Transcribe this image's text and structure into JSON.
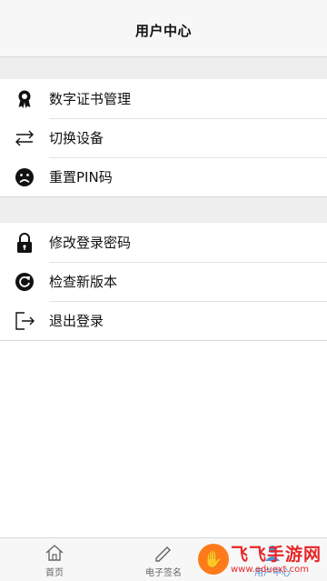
{
  "header": {
    "title": "用户中心"
  },
  "group1": [
    {
      "label": "数字证书管理",
      "icon": "certificate-ribbon-icon"
    },
    {
      "label": "切换设备",
      "icon": "swap-arrows-icon"
    },
    {
      "label": "重置PIN码",
      "icon": "sad-face-icon"
    }
  ],
  "group2": [
    {
      "label": "修改登录密码",
      "icon": "lock-icon"
    },
    {
      "label": "检查新版本",
      "icon": "refresh-icon"
    },
    {
      "label": "退出登录",
      "icon": "logout-icon"
    }
  ],
  "tabbar": {
    "tabs": [
      {
        "label": "首页",
        "icon": "home-icon"
      },
      {
        "label": "电子签名",
        "icon": "signature-icon"
      },
      {
        "label": "用户中心",
        "icon": "user-center-icon",
        "active": true
      }
    ]
  },
  "watermark": {
    "brand": "飞飞手游网",
    "url": "www.eduext.com"
  },
  "colors": {
    "accent": "#4a8fd6",
    "watermark": "#e6262a"
  }
}
